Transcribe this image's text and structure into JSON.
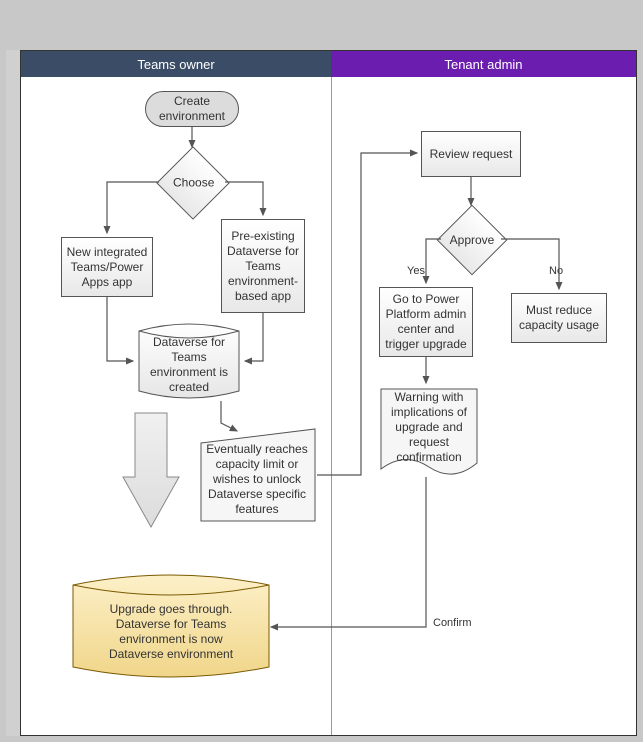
{
  "lanes": {
    "owner": "Teams owner",
    "admin": "Tenant admin"
  },
  "owner_nodes": {
    "create_env": "Create environment",
    "choose": "Choose",
    "new_integrated": "New integrated Teams/Power Apps app",
    "preexisting": "Pre-existing Dataverse for Teams environment-based app",
    "dataverse_created": "Dataverse for Teams environment is created",
    "capacity": "Eventually reaches capacity limit or wishes to unlock Dataverse specific features",
    "upgrade_goes": "Upgrade goes through. Dataverse for Teams environment is now Dataverse environment"
  },
  "admin_nodes": {
    "review": "Review request",
    "approve": "Approve",
    "yes": "Yes",
    "no": "No",
    "goto_admin": "Go to Power Platform admin center and trigger upgrade",
    "reduce": "Must reduce capacity usage",
    "warning": "Warning with implications of upgrade and request confirmation",
    "confirm": "Confirm"
  }
}
